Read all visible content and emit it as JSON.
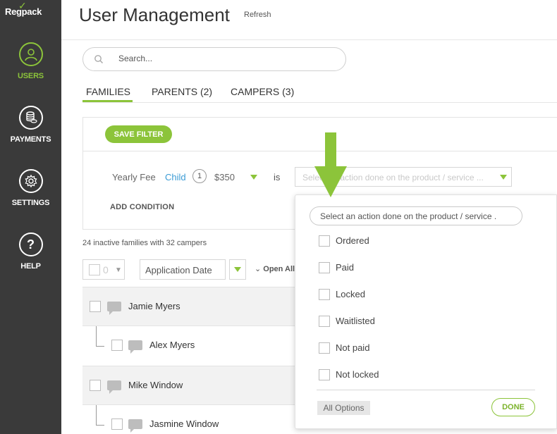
{
  "app": {
    "logo_text": "Regpack",
    "accent_color": "#8cc43a",
    "sidebar_color": "#3a3a3a"
  },
  "sidebar": {
    "items": [
      {
        "label": "USERS",
        "icon": "user-icon",
        "active": true
      },
      {
        "label": "PAYMENTS",
        "icon": "coins-icon",
        "active": false
      },
      {
        "label": "SETTINGS",
        "icon": "gear-icon",
        "active": false
      },
      {
        "label": "HELP",
        "icon": "help-icon",
        "active": false
      }
    ]
  },
  "header": {
    "title": "User Management",
    "refresh_label": "Refresh"
  },
  "search": {
    "placeholder": "Search..."
  },
  "tabs": [
    {
      "label": "FAMILIES",
      "active": true
    },
    {
      "label": "PARENTS (2)",
      "active": false
    },
    {
      "label": "CAMPERS (3)",
      "active": false
    }
  ],
  "filter": {
    "save_label": "SAVE FILTER",
    "condition": {
      "field": "Yearly Fee",
      "entity": "Child",
      "count": "1",
      "amount": "$350",
      "operator": "is",
      "select_placeholder": "Select an action done on the product / service ..."
    },
    "add_condition_label": "ADD CONDITION"
  },
  "summary": "24 inactive families with 32 campers",
  "toolbar": {
    "bulk_count": "0",
    "sort_value": "Application Date",
    "open_all_label": "Open All"
  },
  "rows": [
    {
      "name": "Jamie Myers",
      "type": "parent"
    },
    {
      "name": "Alex Myers",
      "type": "child"
    },
    {
      "name": "Mike Window",
      "type": "parent"
    },
    {
      "name": "Jasmine Window",
      "type": "child"
    }
  ],
  "dropdown": {
    "search_placeholder": "Select an action done on the product / service .",
    "options": [
      "Ordered",
      "Paid",
      "Locked",
      "Waitlisted",
      "Not paid",
      "Not locked"
    ],
    "all_options_label": "All Options",
    "done_label": "DONE"
  }
}
